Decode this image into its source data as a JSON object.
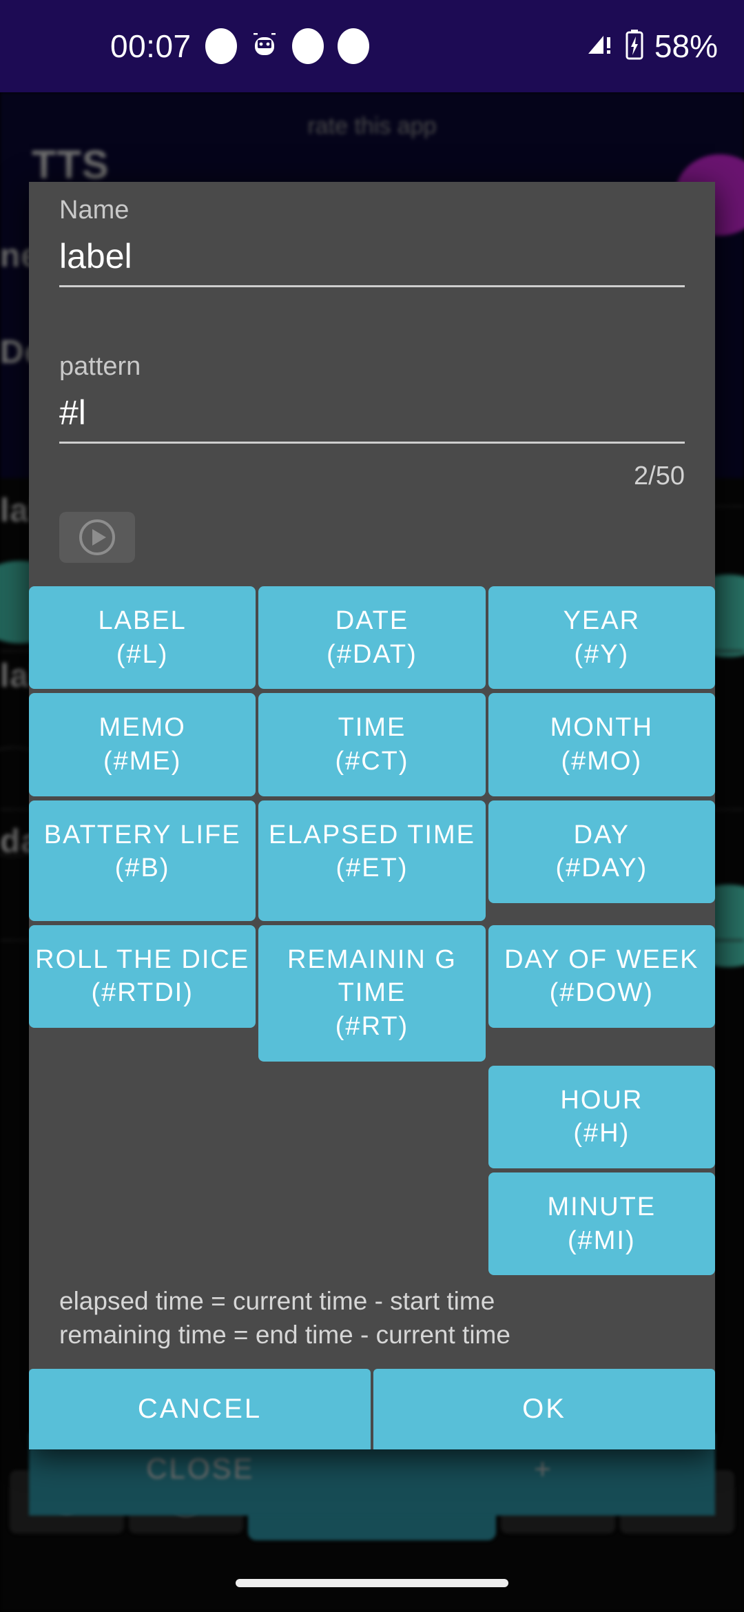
{
  "status_bar": {
    "clock": "00:07",
    "battery_percent": "58%",
    "icons": [
      "notification-dot-icon",
      "android-debug-icon",
      "notification-dot-icon",
      "notification-dot-icon",
      "signal-alert-icon",
      "battery-charging-icon"
    ]
  },
  "background_app": {
    "rate_text": "rate this app",
    "title": "TTS",
    "fragments": [
      "ne",
      "De",
      "lal",
      "lal",
      "da"
    ]
  },
  "dialog": {
    "name_label": "Name",
    "name_value": "label",
    "pattern_label": "pattern",
    "pattern_value": "#l",
    "counter": "2/50",
    "play_icon": "play-icon",
    "tokens": [
      [
        {
          "title": "LABEL",
          "code": "(#L)"
        },
        {
          "title": "DATE",
          "code": "(#DAT)"
        },
        {
          "title": "YEAR",
          "code": "(#Y)"
        }
      ],
      [
        {
          "title": "MEMO",
          "code": "(#ME)"
        },
        {
          "title": "TIME",
          "code": "(#CT)"
        },
        {
          "title": "MONTH",
          "code": "(#MO)"
        }
      ],
      [
        {
          "title": "BATTERY LIFE",
          "code": "(#B)"
        },
        {
          "title": "ELAPSED TIME",
          "code": "(#ET)"
        },
        {
          "title": "DAY",
          "code": "(#DAY)"
        }
      ],
      [
        {
          "title": "ROLL THE DICE",
          "code": "(#RTDI)"
        },
        {
          "title": "REMAININ G TIME",
          "code": "(#RT)"
        },
        {
          "title": "DAY OF WEEK",
          "code": "(#DOW)"
        }
      ],
      [
        {
          "title": "",
          "code": ""
        },
        {
          "title": "",
          "code": ""
        },
        {
          "title": "HOUR",
          "code": "(#H)"
        }
      ],
      [
        {
          "title": "",
          "code": ""
        },
        {
          "title": "",
          "code": ""
        },
        {
          "title": "MINUTE",
          "code": "(#MI)"
        }
      ]
    ],
    "note_line_1": "elapsed time = current time - start time",
    "note_line_2": "remaining time = end time - current time",
    "cancel_label": "CANCEL",
    "ok_label": "OK"
  },
  "behind_dialog": {
    "close_label": "CLOSE",
    "plus_label": "+"
  },
  "toolbar": {
    "keys": [
      {
        "icon": "power-icon",
        "label": ""
      },
      {
        "icon": "info-icon",
        "label": ""
      },
      {
        "icon": "plus-icon",
        "label": "+"
      },
      {
        "icon": "minus-icon",
        "label": "-"
      },
      {
        "icon": "chevron-up-icon",
        "label": ""
      }
    ]
  },
  "colors": {
    "accent": "#58bfd8",
    "dialog_bg": "#4a4a4a",
    "status_bar_bg": "#1d0b54",
    "page_bg": "#000000"
  }
}
